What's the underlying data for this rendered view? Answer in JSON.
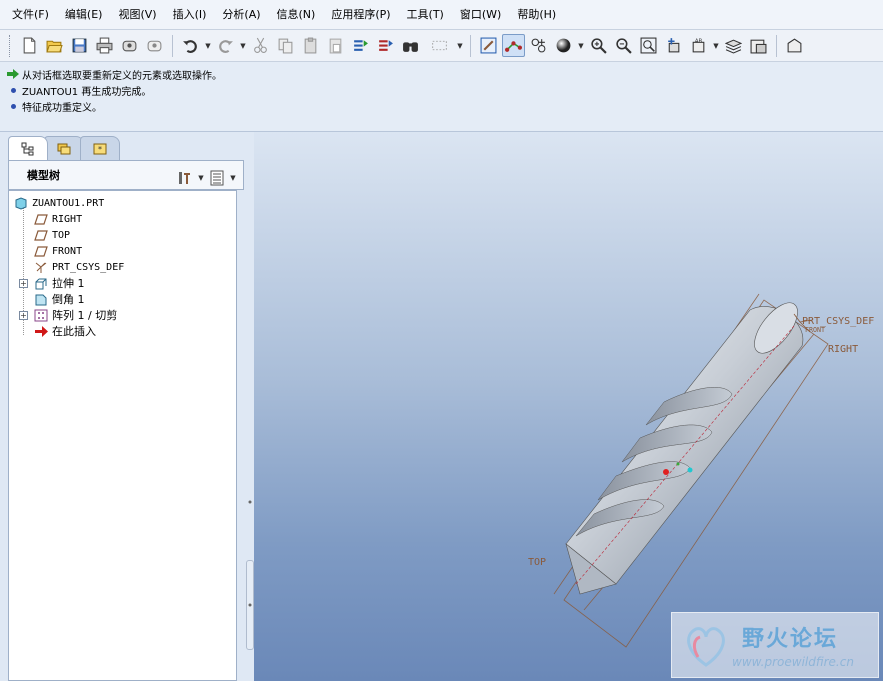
{
  "menu": [
    {
      "label": "文件(F)",
      "name": "menu-file"
    },
    {
      "label": "编辑(E)",
      "name": "menu-edit"
    },
    {
      "label": "视图(V)",
      "name": "menu-view"
    },
    {
      "label": "插入(I)",
      "name": "menu-insert"
    },
    {
      "label": "分析(A)",
      "name": "menu-analysis"
    },
    {
      "label": "信息(N)",
      "name": "menu-info"
    },
    {
      "label": "应用程序(P)",
      "name": "menu-applications"
    },
    {
      "label": "工具(T)",
      "name": "menu-tools"
    },
    {
      "label": "窗口(W)",
      "name": "menu-window"
    },
    {
      "label": "帮助(H)",
      "name": "menu-help"
    }
  ],
  "messages": [
    "从对话框选取要重新定义的元素或选取操作。",
    "ZUANTOU1 再生成功完成。",
    "特征成功重定义。"
  ],
  "panel": {
    "title": "模型树"
  },
  "tree": {
    "root": "ZUANTOU1.PRT",
    "items": [
      {
        "label": "RIGHT",
        "icon": "datum-plane-icon",
        "expandable": false,
        "mono": true
      },
      {
        "label": "TOP",
        "icon": "datum-plane-icon",
        "expandable": false,
        "mono": true
      },
      {
        "label": "FRONT",
        "icon": "datum-plane-icon",
        "expandable": false,
        "mono": true
      },
      {
        "label": "PRT_CSYS_DEF",
        "icon": "csys-icon",
        "expandable": false,
        "mono": true
      },
      {
        "label": "拉伸 1",
        "icon": "extrude-icon",
        "expandable": true,
        "mono": false
      },
      {
        "label": "倒角 1",
        "icon": "chamfer-icon",
        "expandable": false,
        "mono": false
      },
      {
        "label": "阵列 1 / 切剪",
        "icon": "pattern-icon",
        "expandable": true,
        "mono": false
      },
      {
        "label": "在此插入",
        "icon": "insert-here-icon",
        "expandable": false,
        "mono": false
      }
    ]
  },
  "viewport_labels": {
    "csys": "PRT_CSYS_DEF",
    "right": "RIGHT",
    "top": "TOP",
    "front_short": "FRONT"
  },
  "watermark": {
    "text": "野火论坛",
    "url": "www.proewildfire.cn"
  },
  "colors": {
    "accent": "#2e4fae",
    "viewport_top": "#dbe5f2",
    "viewport_bottom": "#6a88b8",
    "datum_label": "#8a5a3a"
  }
}
